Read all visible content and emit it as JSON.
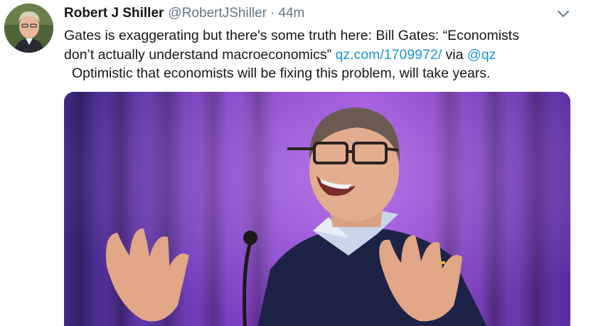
{
  "tweet": {
    "author_name": "Robert J Shiller",
    "author_handle": "@RobertJShiller",
    "separator": "·",
    "time": "44m",
    "line1": "Gates is exaggerating but there's some truth here: Bill Gates: “Economists",
    "line2_prefix": "don’t actually understand macroeconomics” ",
    "link": "qz.com/1709972/",
    "via_text": " via ",
    "mention": "@qz",
    "line3": "Optimistic that economists will be fixing this problem, will take years."
  },
  "icons": {
    "menu": "chevron-down-icon",
    "avatar": "avatar",
    "photo": "bill-gates-photo"
  },
  "colors": {
    "link": "#1b95e0",
    "text": "#14171a",
    "muted": "#657786",
    "curtain": "#6a3fa8"
  }
}
